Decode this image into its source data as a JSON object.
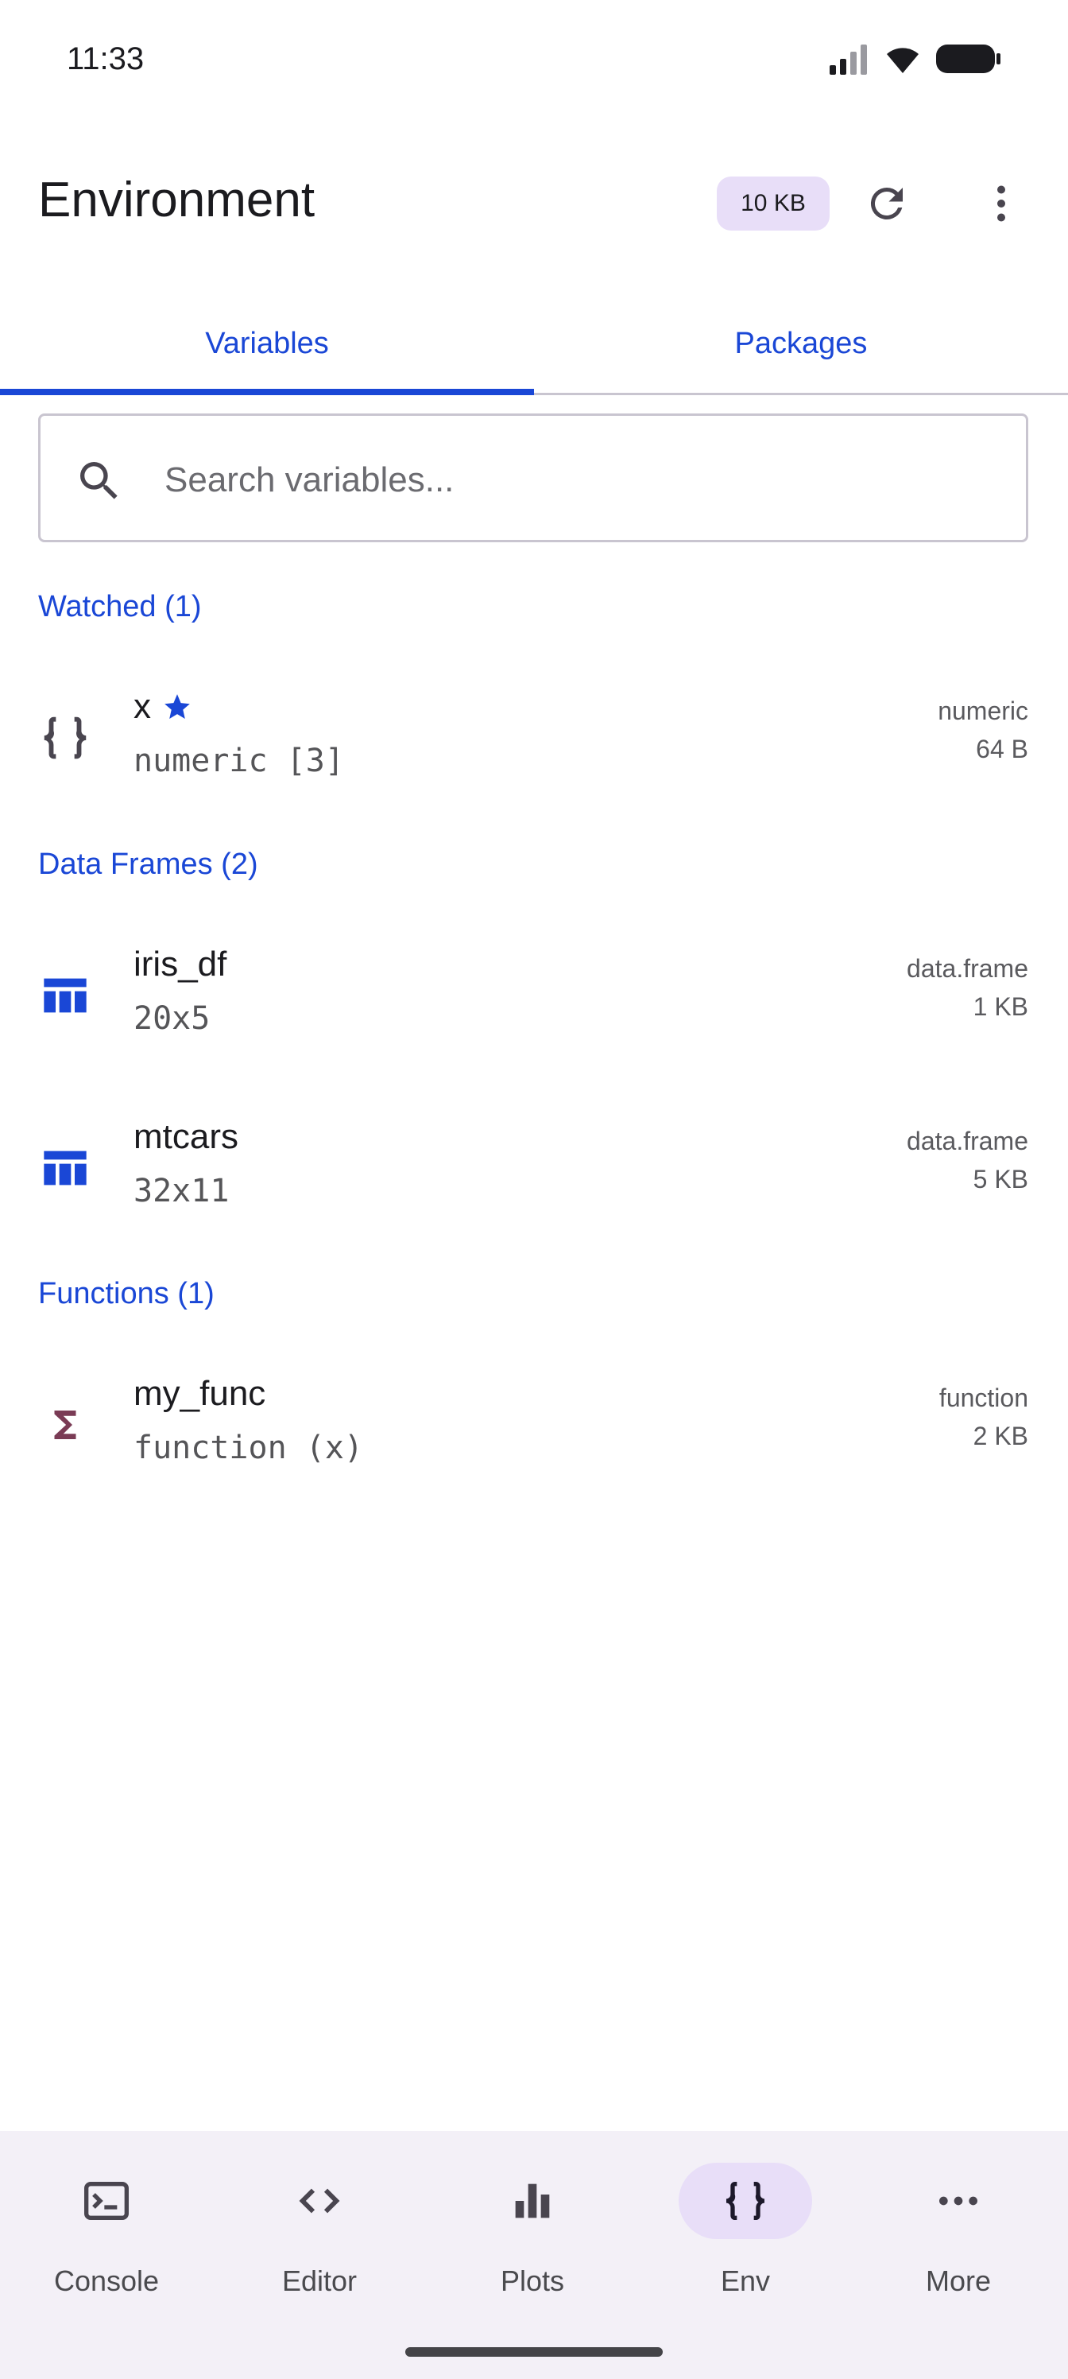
{
  "status_bar": {
    "time": "11:33"
  },
  "app_bar": {
    "title": "Environment",
    "memory_chip": "10 KB"
  },
  "tabs": [
    {
      "label": "Variables",
      "selected": true
    },
    {
      "label": "Packages",
      "selected": false
    }
  ],
  "search": {
    "placeholder": "Search variables..."
  },
  "sections": {
    "watched": {
      "title": "Watched (1)"
    },
    "data_frames": {
      "title": "Data Frames (2)"
    },
    "functions": {
      "title": "Functions (1)"
    }
  },
  "variables": {
    "x": {
      "name": "x",
      "detail": "numeric [3]",
      "type": "numeric",
      "size": "64 B"
    },
    "iris_df": {
      "name": "iris_df",
      "detail": "20x5",
      "type": "data.frame",
      "size": "1 KB"
    },
    "mtcars": {
      "name": "mtcars",
      "detail": "32x11",
      "type": "data.frame",
      "size": "5 KB"
    },
    "my_func": {
      "name": "my_func",
      "detail": "function (x)",
      "type": "function",
      "size": "2 KB"
    }
  },
  "bottom_nav": [
    {
      "label": "Console",
      "icon": "terminal-icon"
    },
    {
      "label": "Editor",
      "icon": "code-icon"
    },
    {
      "label": "Plots",
      "icon": "bar-chart-icon"
    },
    {
      "label": "Env",
      "icon": "braces-icon",
      "selected": true
    },
    {
      "label": "More",
      "icon": "more-horizontal-icon"
    }
  ],
  "colors": {
    "accent": "#1a47d6",
    "chip_bg": "#e8def8",
    "function_icon": "#7a3b55",
    "nav_bg": "#f3f0f7"
  }
}
